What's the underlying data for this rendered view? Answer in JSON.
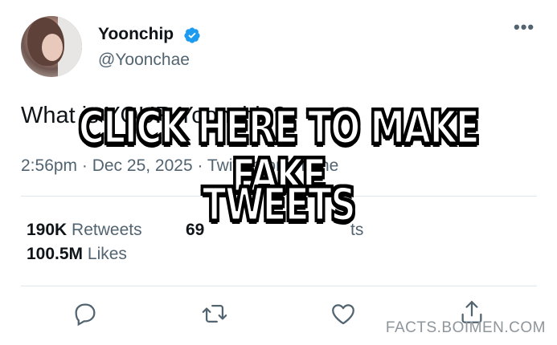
{
  "tweet": {
    "display_name": "Yoonchip",
    "handle": "@Yoonchae",
    "text": "What is YOUR Yoonchip?",
    "timestamp": "2:56pm · Dec 25, 2025 · Twitter for iPhone",
    "retweets_count": "190K",
    "retweets_label": "Retweets",
    "quote_count": "69",
    "quote_label": "ts",
    "likes_count": "100.5M",
    "likes_label": "Likes",
    "verified_color": "#1d9bf0"
  },
  "overlay": {
    "line1": "CLICK HERE TO MAKE FAKE",
    "line2": "TWEETS"
  },
  "watermark": "FACTS.BOIMEN.COM",
  "icons": {
    "more": "more-options-icon",
    "reply": "reply-icon",
    "retweet": "retweet-icon",
    "like": "heart-icon",
    "share": "share-icon"
  }
}
